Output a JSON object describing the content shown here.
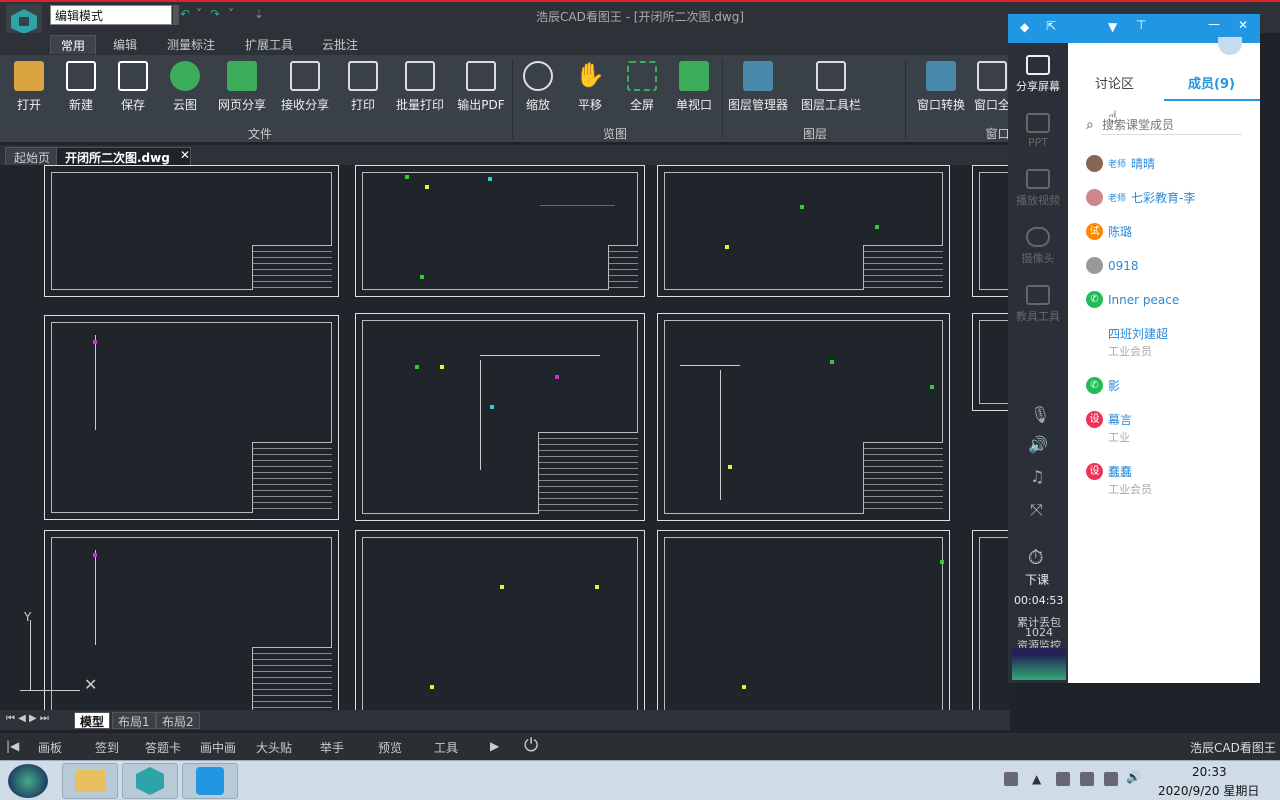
{
  "app": {
    "title": "浩辰CAD看图王 - [开闭所二次图.dwg]",
    "mode_value": "编辑模式",
    "status_name": "浩辰CAD看图王"
  },
  "ribbon_tabs": [
    "常用",
    "编辑",
    "测量标注",
    "扩展工具",
    "云批注"
  ],
  "toolbar": [
    "打开",
    "新建",
    "保存",
    "云图",
    "网页分享",
    "接收分享",
    "打印",
    "批量打印",
    "输出PDF",
    "缩放",
    "平移",
    "全屏",
    "单视口",
    "图层管理器",
    "图层工具栏",
    "窗口转换",
    "窗口全"
  ],
  "groups": [
    "文件",
    "览图",
    "图层",
    "窗口"
  ],
  "doc_tabs": [
    "起始页",
    "开闭所二次图.dwg"
  ],
  "layout_tabs": [
    "模型",
    "布局1",
    "布局2"
  ],
  "bottom_tools": [
    "画板",
    "签到",
    "答题卡",
    "画中画",
    "大头贴",
    "举手",
    "预览",
    "工具"
  ],
  "panel": {
    "tabs": [
      "讨论区",
      "成员(9)"
    ],
    "search_placeholder": "搜索课堂成员",
    "tools": [
      "分享屏幕",
      "PPT",
      "播放视频",
      "摄像头",
      "教具工具"
    ],
    "end_label": "下课",
    "timer": "00:04:53",
    "packet_label": "累计丢包",
    "packet_value": "1024",
    "monitor_label": "资源监控",
    "members": [
      {
        "tag": "老师",
        "name": "晴晴",
        "role": ""
      },
      {
        "tag": "老师",
        "name": "七彩教育-李",
        "role": ""
      },
      {
        "tag": "",
        "name": "陈璐",
        "role": ""
      },
      {
        "tag": "",
        "name": "0918",
        "role": ""
      },
      {
        "tag": "",
        "name": "Inner peace",
        "role": ""
      },
      {
        "tag": "",
        "name": "四班刘建超",
        "role": "工业会员"
      },
      {
        "tag": "",
        "name": "影",
        "role": ""
      },
      {
        "tag": "",
        "name": "幕言",
        "role": "工业"
      },
      {
        "tag": "",
        "name": "蠢蠢",
        "role": "工业会员"
      }
    ]
  },
  "taskbar": {
    "time": "20:33",
    "date": "2020/9/20 星期日"
  },
  "colors": {
    "accent": "#2196e3",
    "titlebar": "#2d3238",
    "alert": "#e0202a"
  }
}
